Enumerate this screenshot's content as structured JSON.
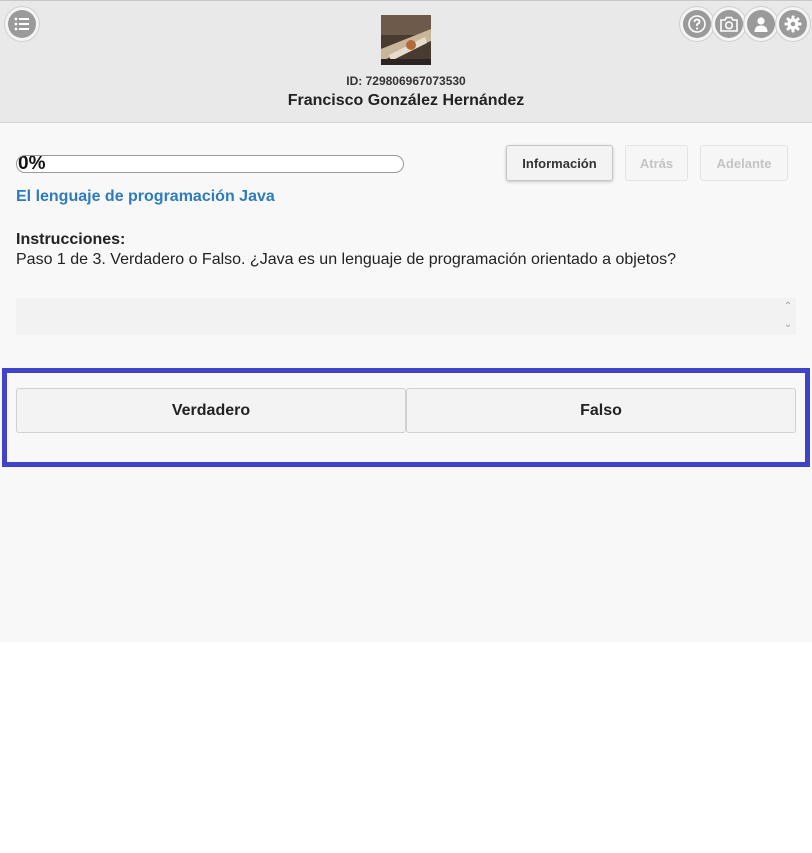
{
  "header": {
    "user_id": "ID: 729806967073530",
    "user_name": "Francisco González Hernández"
  },
  "toolbar": {
    "info_label": "Información",
    "back_label": "Atrás",
    "next_label": "Adelante"
  },
  "progress": {
    "percent_text": "0%",
    "value": 0
  },
  "lesson": {
    "title": "El lenguaje de programación Java",
    "instructions_label": "Instrucciones:",
    "instructions_text": "Paso 1 de 3. Verdadero o Falso. ¿Java es un lenguaje de programación orientado a objetos?"
  },
  "answers": {
    "true_label": "Verdadero",
    "false_label": "Falso"
  },
  "colors": {
    "accent_link": "#2e7bbd",
    "highlight_border": "#3f43c9",
    "header_bg": "#e9e9e9",
    "icon_gray": "#9a9a9a"
  },
  "icons": [
    "list-icon",
    "help-icon",
    "camera-icon",
    "user-icon",
    "gear-icon"
  ]
}
